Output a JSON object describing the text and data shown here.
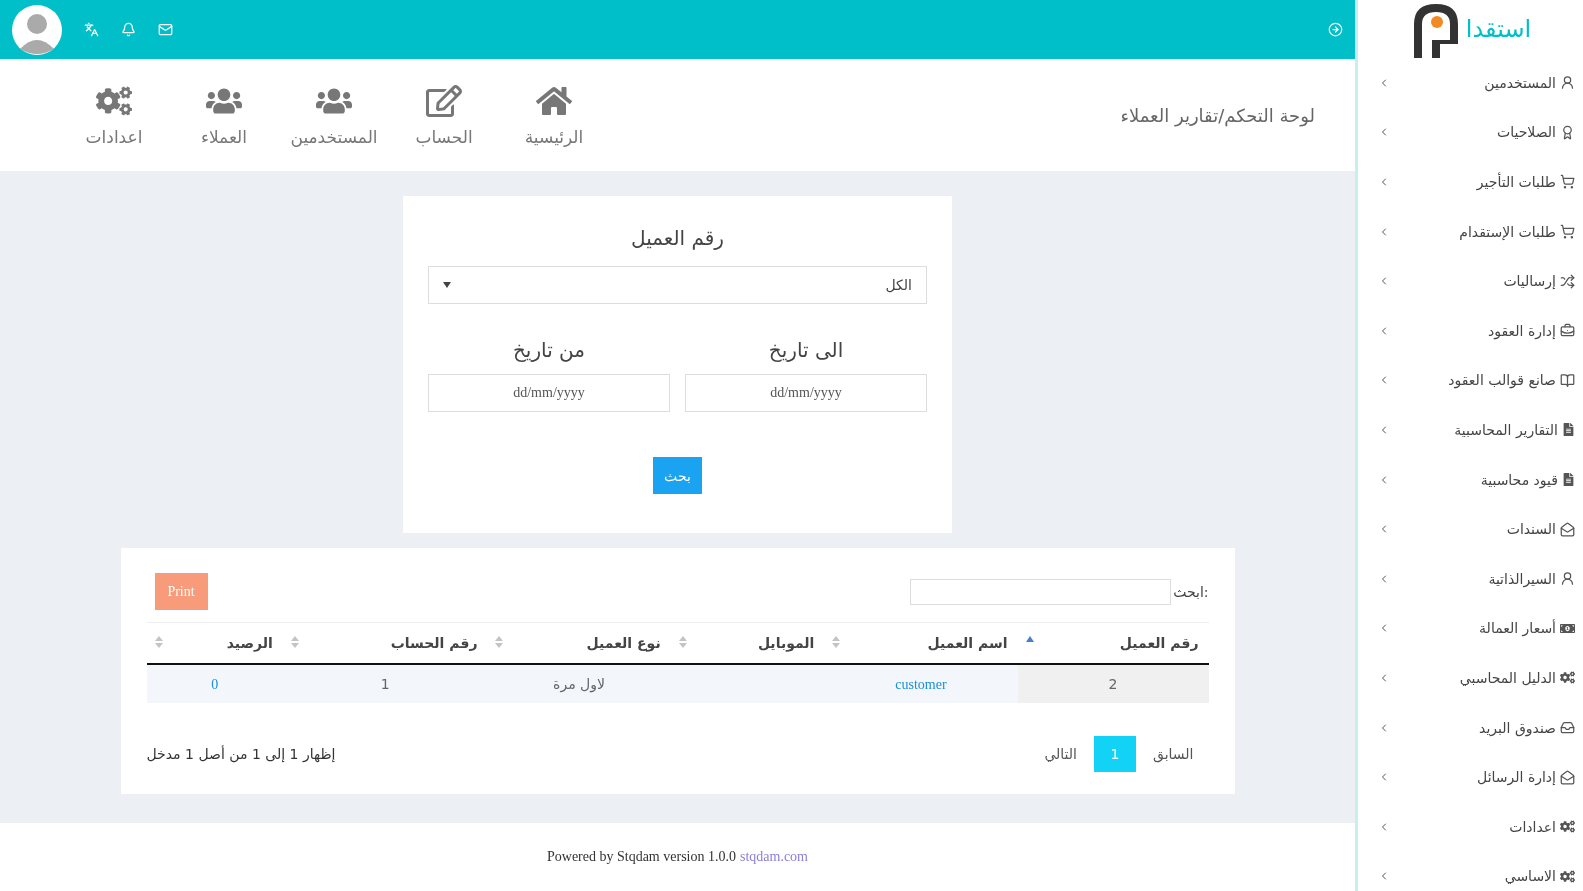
{
  "breadcrumb": "لوحة التحكم/تقارير العملاء",
  "nav": [
    {
      "label": "الرئيسية"
    },
    {
      "label": "الحساب"
    },
    {
      "label": "المستخدمين"
    },
    {
      "label": "العملاء"
    },
    {
      "label": "اعدادات"
    }
  ],
  "filter": {
    "title": "رقم العميل",
    "select_value": "الكل",
    "to_label": "الى تاريخ",
    "to_placeholder": "dd/mm/yyyy",
    "from_label": "من تاريخ",
    "from_placeholder": "dd/mm/yyyy",
    "button": "بحث"
  },
  "table_card": {
    "search_label": "ابحث:",
    "print": "Print",
    "columns": [
      {
        "label": "رقم العميل",
        "sorted": true
      },
      {
        "label": "اسم العميل",
        "sorted": false
      },
      {
        "label": "الموبايل",
        "sorted": false
      },
      {
        "label": "نوع العميل",
        "sorted": false
      },
      {
        "label": "رقم الحساب",
        "sorted": false
      },
      {
        "label": "الرصيد",
        "sorted": false
      }
    ],
    "rows": [
      {
        "cells": [
          {
            "text": "2",
            "kind": "plain"
          },
          {
            "text": "customer",
            "kind": "link"
          },
          {
            "kind": "empty"
          },
          {
            "text": "لاول مرة",
            "kind": "plain"
          },
          {
            "text": "1",
            "kind": "plain"
          },
          {
            "text": "0",
            "kind": "link"
          }
        ]
      }
    ],
    "pagination": [
      {
        "label": "السابق",
        "selected": false
      },
      {
        "label": "1",
        "selected": true
      },
      {
        "label": "التالي",
        "selected": false
      }
    ],
    "info": "إظهار 1 إلى 1 من أصل 1 مدخل"
  },
  "footer": {
    "text": "Powered by Stqdam version 1.0.0",
    "link": "stqdam.com"
  },
  "sidebar": {
    "logo": "استقدا",
    "items": [
      {
        "label": "المستخدمين"
      },
      {
        "label": "الصلاحيات"
      },
      {
        "label": "طلبات التأجير"
      },
      {
        "label": "طلبات الإستقدام"
      },
      {
        "label": "إرساليات"
      },
      {
        "label": "إدارة العقود"
      },
      {
        "label": "صانع قوالب العقود"
      },
      {
        "label": "التقارير المحاسبية"
      },
      {
        "label": "قيود محاسبية"
      },
      {
        "label": "السندات"
      },
      {
        "label": "السيرالذاتية"
      },
      {
        "label": "أسعار العمالة"
      },
      {
        "label": "الدليل المحاسبي"
      },
      {
        "label": "صندوق البريد"
      },
      {
        "label": "إدارة الرسائل"
      },
      {
        "label": "اعدادات"
      },
      {
        "label": "الاساسي"
      }
    ]
  }
}
